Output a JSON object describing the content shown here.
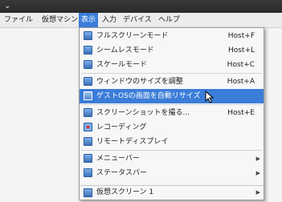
{
  "titlebar": {
    "icon": "chevron-down-icon"
  },
  "menubar": {
    "file": "ファイル",
    "machine": "仮想マシン",
    "view": "表示",
    "input": "入力",
    "devices": "デバイス",
    "help": "ヘルプ"
  },
  "menu": {
    "items": [
      {
        "label": "フルスクリーンモード",
        "shortcut": "Host+F",
        "icon": "fullscreen-icon"
      },
      {
        "label": "シームレスモード",
        "shortcut": "Host+L",
        "icon": "seamless-icon"
      },
      {
        "label": "スケールモード",
        "shortcut": "Host+C",
        "icon": "scale-icon"
      },
      {
        "label": "ウィンドウのサイズを調整",
        "shortcut": "Host+A",
        "icon": "adjust-window-icon"
      },
      {
        "label": "ゲストOSの画面を自動リサイズ",
        "shortcut": "",
        "icon": "auto-resize-icon"
      },
      {
        "label": "スクリーンショットを撮る...",
        "shortcut": "Host+E",
        "icon": "screenshot-icon"
      },
      {
        "label": "レコーディング",
        "shortcut": "",
        "icon": "recording-icon"
      },
      {
        "label": "リモートディスプレイ",
        "shortcut": "",
        "icon": "remote-display-icon"
      },
      {
        "label": "メニューバー",
        "shortcut": "",
        "icon": "menubar-icon"
      },
      {
        "label": "ステータスバー",
        "shortcut": "",
        "icon": "statusbar-icon"
      },
      {
        "label": "仮想スクリーン 1",
        "shortcut": "",
        "icon": "virtual-screen-icon"
      }
    ],
    "highlighted_index": 4,
    "colors": {
      "highlight": "#3b7dd8",
      "icon": "#3a6fb8"
    }
  }
}
